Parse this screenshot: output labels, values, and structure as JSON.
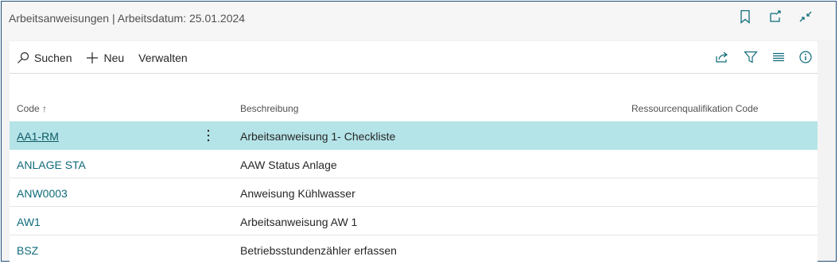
{
  "header": {
    "title": "Arbeitsanweisungen | Arbeitsdatum: 25.01.2024",
    "icons": [
      "bookmark-icon",
      "open-new-window-icon",
      "collapse-icon"
    ]
  },
  "toolbar": {
    "search_label": "Suchen",
    "new_label": "Neu",
    "manage_label": "Verwalten",
    "right_icons": [
      "share-icon",
      "filter-icon",
      "list-view-icon",
      "info-icon"
    ]
  },
  "columns": {
    "code": "Code ↑",
    "description": "Beschreibung",
    "resource_qualification": "Ressourcenqualifikation Code"
  },
  "rows": [
    {
      "code": "AA1-RM",
      "description": "Arbeitsanweisung 1- Checkliste",
      "resource_qualification": ""
    },
    {
      "code": "ANLAGE STA",
      "description": "AAW Status Anlage",
      "resource_qualification": ""
    },
    {
      "code": "ANW0003",
      "description": "Anweisung Kühlwasser",
      "resource_qualification": ""
    },
    {
      "code": "AW1",
      "description": "Arbeitsanweisung AW 1",
      "resource_qualification": ""
    },
    {
      "code": "BSZ",
      "description": "Betriebsstundenzähler erfassen",
      "resource_qualification": ""
    }
  ],
  "selected_row": 0,
  "colors": {
    "accent": "#0f6b7a",
    "selected_row_bg": "#b5e4e8",
    "frame_border": "#1f4e79"
  }
}
